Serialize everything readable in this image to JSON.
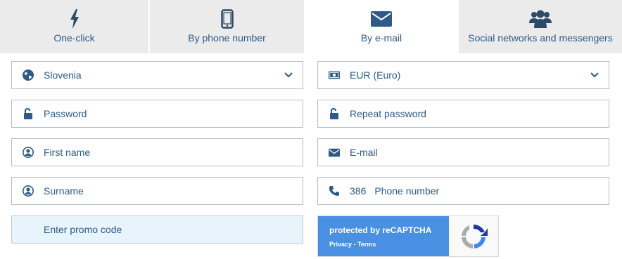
{
  "tabs": [
    {
      "label": "One-click",
      "icon": "lightning-icon",
      "active": false
    },
    {
      "label": "By phone number",
      "icon": "smartphone-icon",
      "active": false
    },
    {
      "label": "By e-mail",
      "icon": "envelope-icon",
      "active": true
    },
    {
      "label": "Social networks and messengers",
      "icon": "users-icon",
      "active": false
    }
  ],
  "form": {
    "country": {
      "value": "Slovenia",
      "icon": "globe-icon"
    },
    "currency": {
      "value": "EUR (Euro)",
      "icon": "banknote-icon"
    },
    "password": {
      "placeholder": "Password",
      "icon": "unlock-icon"
    },
    "repeat_password": {
      "placeholder": "Repeat password",
      "icon": "unlock-icon"
    },
    "first_name": {
      "placeholder": "First name",
      "icon": "user-circle-icon"
    },
    "email": {
      "placeholder": "E-mail",
      "icon": "envelope-icon"
    },
    "surname": {
      "placeholder": "Surname",
      "icon": "user-circle-icon"
    },
    "phone": {
      "prefix": "386",
      "placeholder": "Phone number",
      "icon": "phone-icon"
    },
    "promo": {
      "placeholder": "Enter promo code"
    }
  },
  "recaptcha": {
    "title": "protected by reCAPTCHA",
    "links": "Privacy - Terms"
  },
  "colors": {
    "accent": "#2d5a86",
    "tab_bg": "#ebebeb",
    "promo_bg": "#e8f4fc",
    "recaptcha_blue": "#4a90e2"
  }
}
